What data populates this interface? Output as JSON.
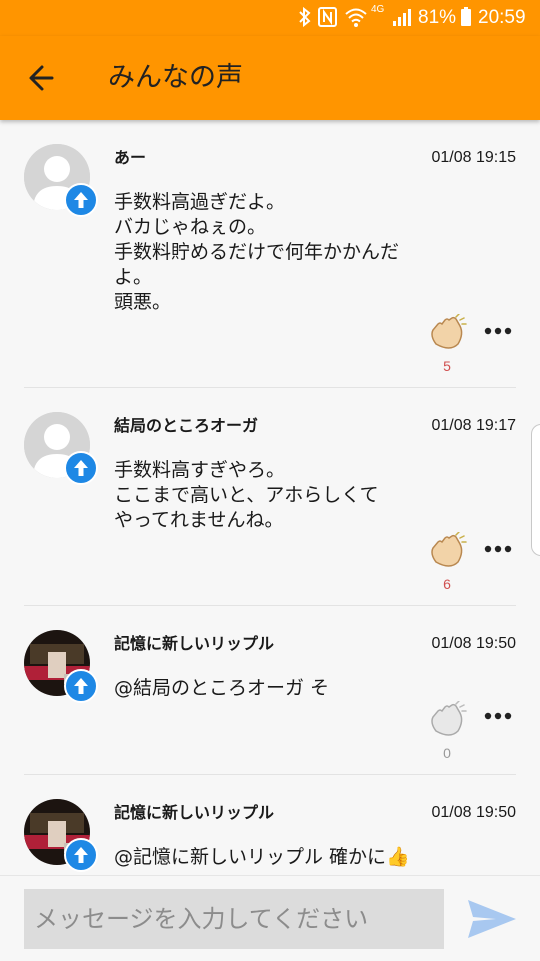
{
  "status_bar": {
    "battery": "81%",
    "time": "20:59",
    "network": "4G"
  },
  "header": {
    "title": "みんなの声"
  },
  "posts": [
    {
      "author": "あー",
      "time": "01/08 19:15",
      "lines": [
        "手数料高過ぎだよ。",
        "バカじゃねぇの。",
        "手数料貯めるだけで何年かかんだ",
        "よ。",
        "頭悪。"
      ],
      "claps": "5",
      "avatar": "default"
    },
    {
      "author": "結局のところオーガ",
      "time": "01/08 19:17",
      "lines": [
        "手数料高すぎやろ。",
        "ここまで高いと、アホらしくて",
        "やってれませんね。"
      ],
      "claps": "6",
      "avatar": "default"
    },
    {
      "author": "記憶に新しいリップル",
      "time": "01/08 19:50",
      "lines": [
        "@結局のところオーガ そ"
      ],
      "claps": "0",
      "avatar": "photo"
    },
    {
      "author": "記憶に新しいリップル",
      "time": "01/08 19:50",
      "lines": [
        "@記憶に新しいリップル 確かに👍"
      ],
      "claps": "",
      "avatar": "photo"
    }
  ],
  "composer": {
    "placeholder": "メッセージを入力してください"
  },
  "colors": {
    "accent": "#ff9500",
    "badge": "#1e88e5",
    "clap_count_active": "#d05050",
    "clap_count_zero": "#999999",
    "send": "#a8c8f0"
  }
}
